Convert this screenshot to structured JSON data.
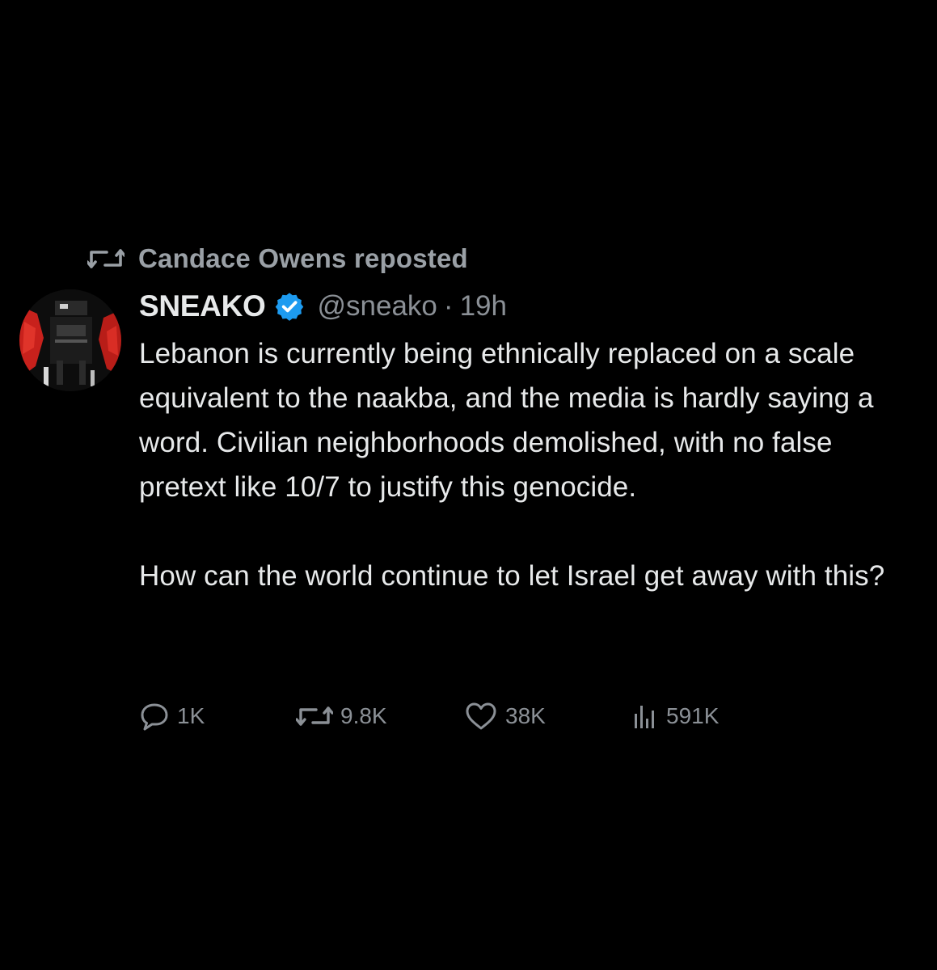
{
  "repost_banner": {
    "icon": "repost-icon",
    "text": "Candace Owens reposted"
  },
  "author": {
    "display_name": "SNEAKO",
    "verified_icon": "verified-badge-icon",
    "verified_color": "#1d9bf0",
    "handle": "@sneako",
    "separator": "·",
    "time": "19h"
  },
  "tweet": {
    "paragraphs": [
      "Lebanon is currently being ethnically replaced on a scale equivalent to the naakba, and the media is hardly saying a word. Civilian neighborhoods demolished, with no false pretext like 10/7 to justify this genocide.",
      "How can the world continue to let Israel get away with this?"
    ]
  },
  "actions": {
    "replies": {
      "icon": "reply-icon",
      "count": "1K"
    },
    "reposts": {
      "icon": "repost-icon",
      "count": "9.8K"
    },
    "likes": {
      "icon": "heart-icon",
      "count": "38K"
    },
    "views": {
      "icon": "views-icon",
      "count": "591K"
    }
  },
  "colors": {
    "background": "#000000",
    "text_primary": "#e7e9ea",
    "text_secondary": "#8b9096"
  }
}
